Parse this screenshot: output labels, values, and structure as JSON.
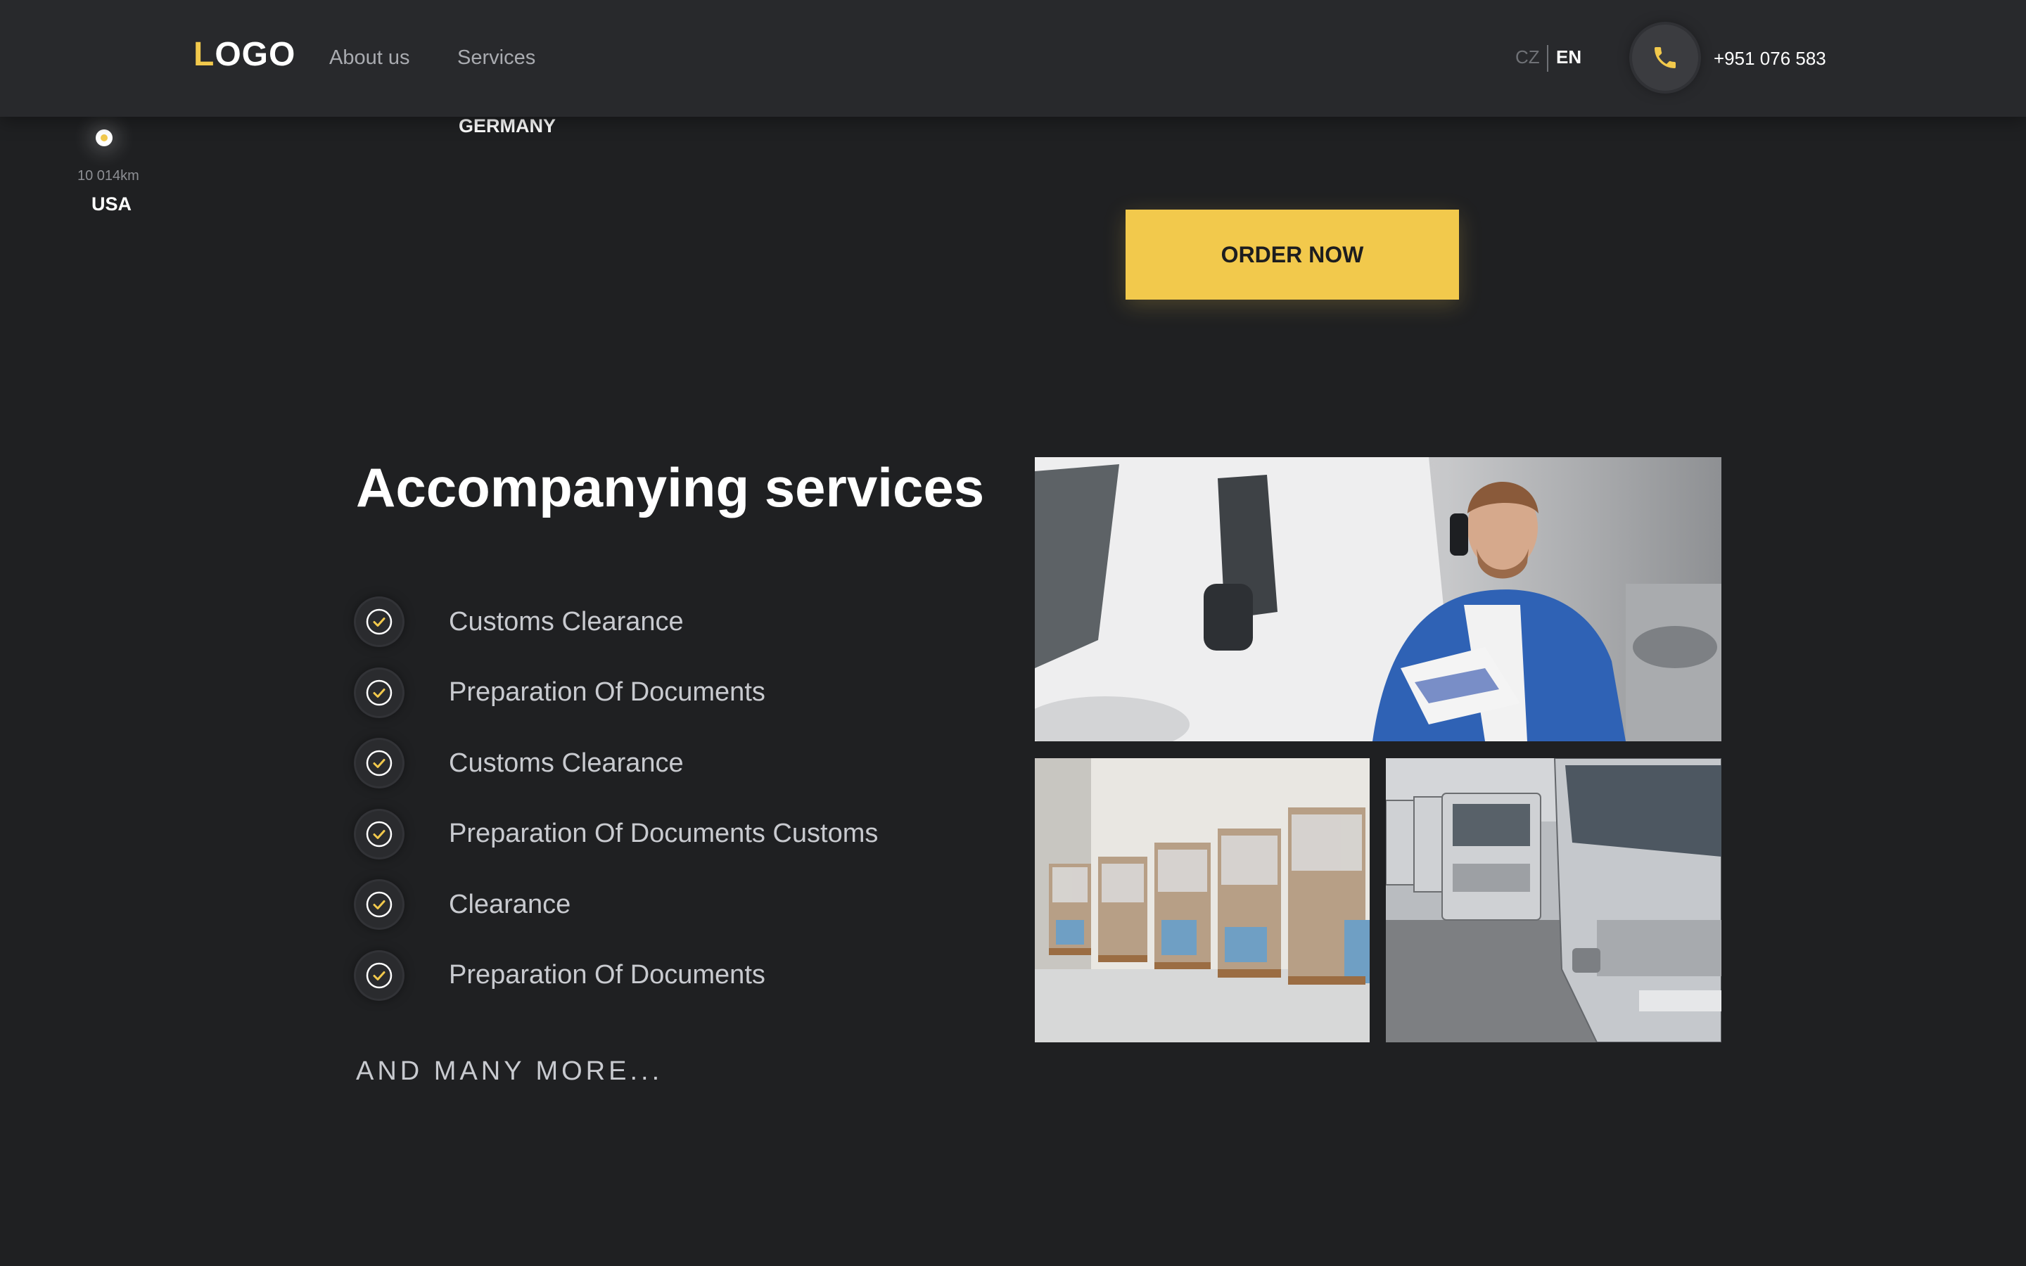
{
  "header": {
    "logo": {
      "first_letter": "L",
      "rest": "OGO"
    },
    "nav": [
      {
        "label": "About us"
      },
      {
        "label": "Services"
      }
    ],
    "languages": [
      {
        "code": "CZ",
        "active": false
      },
      {
        "code": "EN",
        "active": true
      }
    ],
    "phone": {
      "icon": "phone-icon",
      "number": "+951 076 583"
    }
  },
  "map": {
    "points": [
      {
        "distance": "10 014km",
        "country": "USA"
      },
      {
        "country": "GERMANY"
      }
    ]
  },
  "order_button": "ORDER NOW",
  "services": {
    "title": "Accompanying services",
    "items": [
      {
        "label": "Customs Clearance",
        "icon": "check-circle-icon"
      },
      {
        "label": "Preparation Of Documents",
        "icon": "check-circle-icon"
      },
      {
        "label": "Customs Clearance",
        "icon": "check-circle-icon"
      },
      {
        "label": "Preparation Of Documents Customs",
        "icon": "check-circle-icon"
      },
      {
        "label": "Clearance",
        "icon": "check-circle-icon"
      },
      {
        "label": "Preparation Of Documents",
        "icon": "check-circle-icon"
      }
    ],
    "more": "AND MANY MORE..."
  },
  "colors": {
    "accent": "#f2c94c",
    "background": "#1f2022",
    "header": "#28292c",
    "muted_text": "#c8cacf"
  }
}
